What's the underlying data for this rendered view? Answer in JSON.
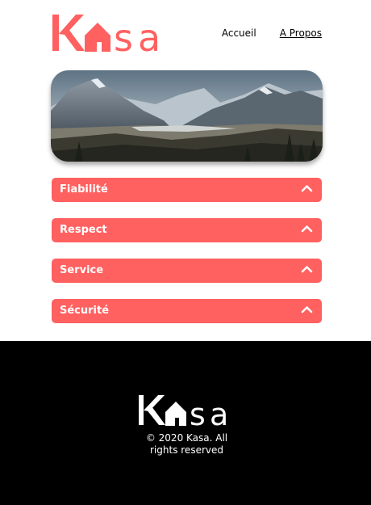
{
  "brand": {
    "logo_text": "Kasa",
    "accent_color": "#ff6060"
  },
  "nav": {
    "items": [
      {
        "label": "Accueil"
      },
      {
        "label": "A Propos"
      }
    ]
  },
  "banner": {
    "image": "mountain-landscape"
  },
  "sections": [
    {
      "label": "Fiabilité",
      "icon": "chevron-up-icon"
    },
    {
      "label": "Respect",
      "icon": "chevron-up-icon"
    },
    {
      "label": "Service",
      "icon": "chevron-up-icon"
    },
    {
      "label": "Sécurité",
      "icon": "chevron-up-icon"
    }
  ],
  "footer": {
    "copyright": "© 2020 Kasa. All rights reserved"
  }
}
